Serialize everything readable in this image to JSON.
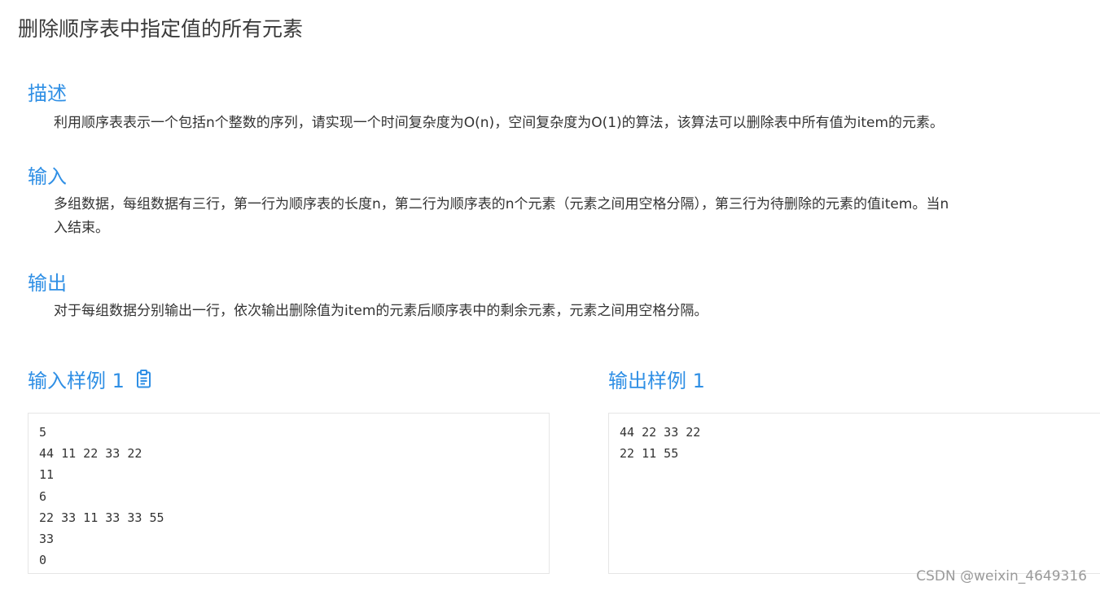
{
  "problem": {
    "title": "删除顺序表中指定值的所有元素"
  },
  "sections": {
    "description": {
      "heading": "描述",
      "text": "利用顺序表表示一个包括n个整数的序列，请实现一个时间复杂度为O(n)，空间复杂度为O(1)的算法，该算法可以删除表中所有值为item的元素。"
    },
    "input": {
      "heading": "输入",
      "line1": "多组数据，每组数据有三行，第一行为顺序表的长度n，第二行为顺序表的n个元素（元素之间用空格分隔），第三行为待删除的元素的值item。当n",
      "line2": "入结束。"
    },
    "output": {
      "heading": "输出",
      "text": "对于每组数据分别输出一行，依次输出删除值为item的元素后顺序表中的剩余元素，元素之间用空格分隔。"
    }
  },
  "samples": {
    "input_heading": "输入样例 1",
    "output_heading": "输出样例 1",
    "input_lines": [
      "5",
      "44 11 22 33 22",
      "11",
      "6",
      "22 33 11 33 33 55",
      "33",
      "0"
    ],
    "output_lines": [
      "44 22 33 22",
      "22 11 55"
    ]
  },
  "watermark": "CSDN @weixin_4649316",
  "icons": {
    "copy": "clipboard-copy-icon"
  },
  "colors": {
    "accent": "#2f8fe5",
    "text": "#333333",
    "border": "#e6e6e6"
  }
}
